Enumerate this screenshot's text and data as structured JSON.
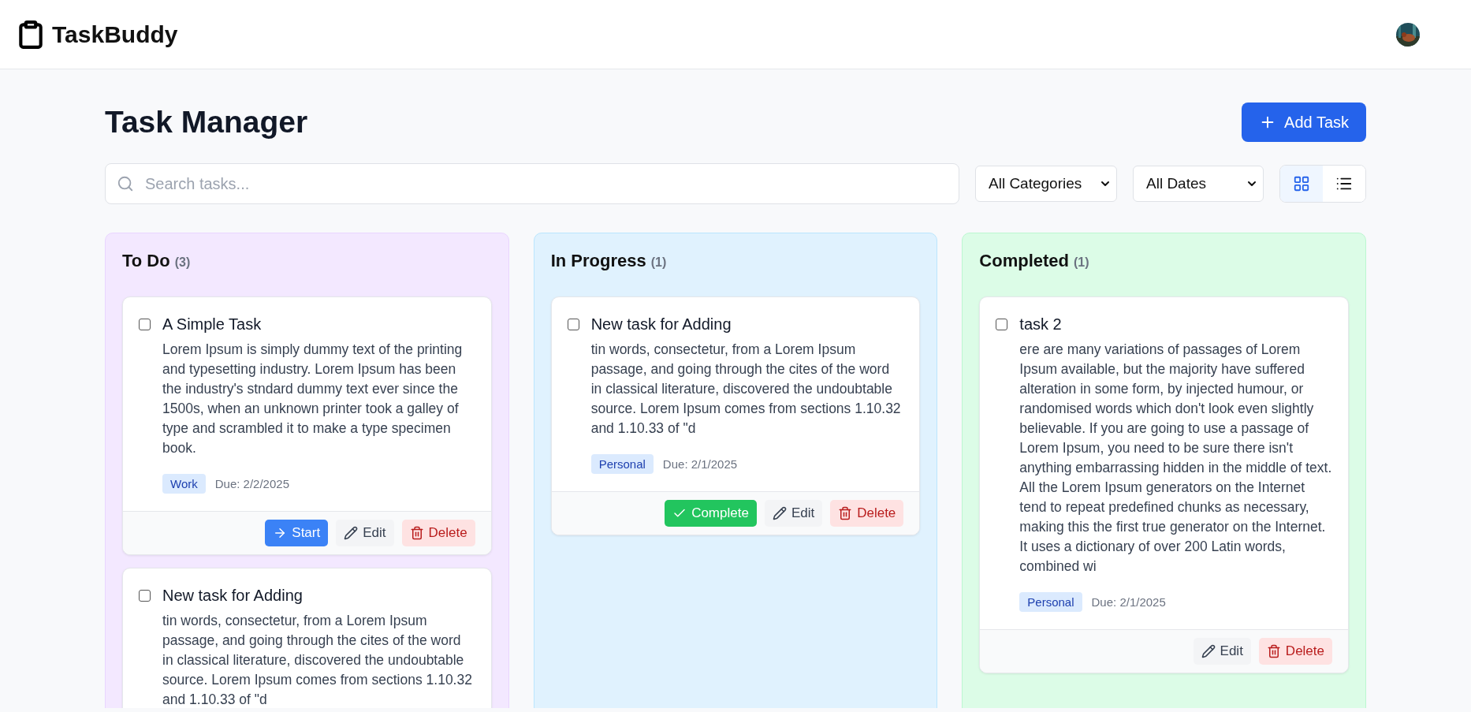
{
  "header": {
    "brand": "TaskBuddy"
  },
  "page": {
    "title": "Task Manager",
    "add_button": "Add Task"
  },
  "filters": {
    "search_placeholder": "Search tasks...",
    "category": "All Categories",
    "date": "All Dates",
    "views": [
      {
        "kind": "grid",
        "selected": true
      },
      {
        "kind": "list",
        "selected": false
      }
    ]
  },
  "columns": [
    {
      "title": "To Do",
      "count": "(3)",
      "kind": "todo",
      "tasks": [
        {
          "title": "A Simple Task",
          "checked": false,
          "description": "Lorem Ipsum is simply dummy text of the printing and typesetting industry. Lorem Ipsum has been the industry's stndard dummy text ever since the 1500s, when an unknown printer took a galley of type and scrambled it to make a type specimen book.",
          "tag": "Work",
          "due": "Due: 2/2/2025",
          "actions": [
            {
              "kind": "start",
              "label": "Start"
            },
            {
              "kind": "edit",
              "label": "Edit"
            },
            {
              "kind": "delete",
              "label": "Delete"
            }
          ]
        },
        {
          "title": "New task for Adding",
          "checked": false,
          "description": "tin words, consectetur, from a Lorem Ipsum passage, and going through the cites of the word in classical literature, discovered the undoubtable source. Lorem Ipsum comes from sections 1.10.32 and 1.10.33 of \"d"
        }
      ]
    },
    {
      "title": "In Progress",
      "count": "(1)",
      "kind": "progress",
      "tasks": [
        {
          "title": "New task for Adding",
          "checked": false,
          "description": "tin words, consectetur, from a Lorem Ipsum passage, and going through the cites of the word in classical literature, discovered the undoubtable source. Lorem Ipsum comes from sections 1.10.32 and 1.10.33 of \"d",
          "tag": "Personal",
          "due": "Due: 2/1/2025",
          "actions": [
            {
              "kind": "complete",
              "label": "Complete"
            },
            {
              "kind": "edit",
              "label": "Edit"
            },
            {
              "kind": "delete",
              "label": "Delete"
            }
          ]
        }
      ]
    },
    {
      "title": "Completed",
      "count": "(1)",
      "kind": "done",
      "tasks": [
        {
          "title": "task 2",
          "checked": false,
          "description": "ere are many variations of passages of Lorem Ipsum available, but the majority have suffered alteration in some form, by injected humour, or randomised words which don't look even slightly believable. If you are going to use a passage of Lorem Ipsum, you need to be sure there isn't anything embarrassing hidden in the middle of text. All the Lorem Ipsum generators on the Internet tend to repeat predefined chunks as necessary, making this the first true generator on the Internet. It uses a dictionary of over 200 Latin words, combined wi",
          "tag": "Personal",
          "due": "Due: 2/1/2025",
          "actions": [
            {
              "kind": "edit",
              "label": "Edit"
            },
            {
              "kind": "delete",
              "label": "Delete"
            }
          ]
        }
      ]
    }
  ]
}
